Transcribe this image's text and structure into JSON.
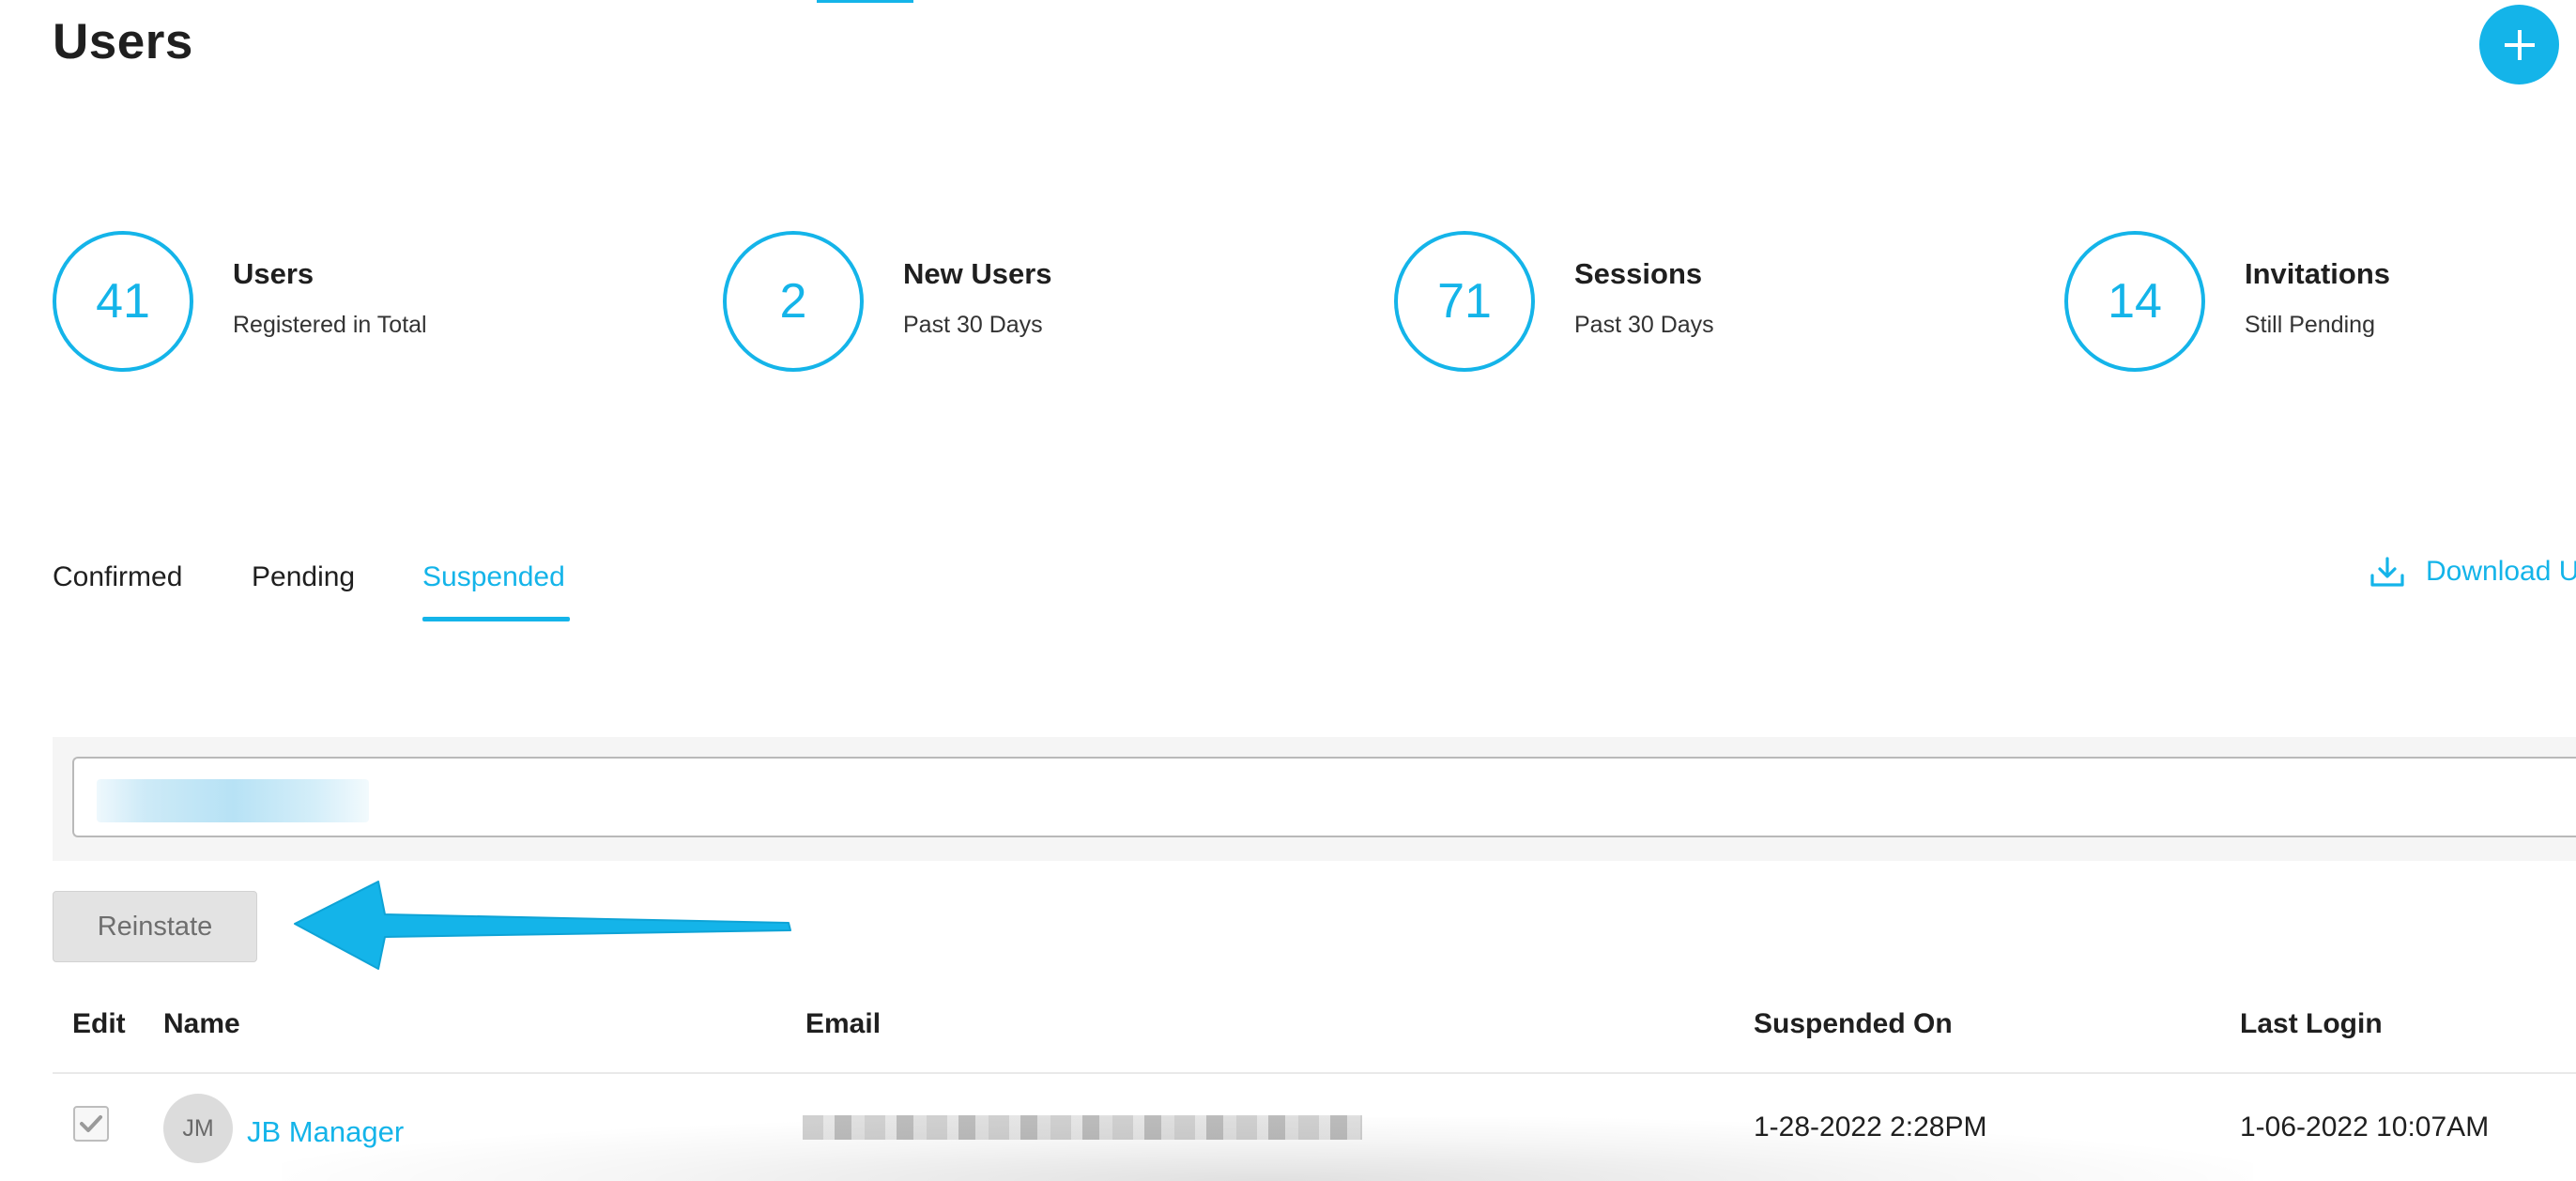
{
  "header": {
    "title": "Users",
    "add_button_icon": "plus-icon"
  },
  "stats": [
    {
      "value": "41",
      "label": "Users",
      "sub": "Registered in Total"
    },
    {
      "value": "2",
      "label": "New Users",
      "sub": "Past 30 Days"
    },
    {
      "value": "71",
      "label": "Sessions",
      "sub": "Past 30 Days"
    },
    {
      "value": "14",
      "label": "Invitations",
      "sub": "Still Pending"
    }
  ],
  "tabs": [
    {
      "label": "Confirmed",
      "active": false
    },
    {
      "label": "Pending",
      "active": false
    },
    {
      "label": "Suspended",
      "active": true
    }
  ],
  "download": {
    "label": "Download U",
    "icon": "download-icon"
  },
  "actions": {
    "reinstate_label": "Reinstate"
  },
  "table": {
    "columns": [
      "Edit",
      "Name",
      "Email",
      "Suspended On",
      "Last Login"
    ],
    "rows": [
      {
        "checked": true,
        "initials": "JM",
        "name": "JB Manager",
        "suspended_on": "1-28-2022 2:28PM",
        "last_login": "1-06-2022 10:07AM"
      }
    ]
  },
  "colors": {
    "accent": "#14b4e9",
    "text": "#1f1f1f",
    "button_bg": "#e3e3e3"
  }
}
